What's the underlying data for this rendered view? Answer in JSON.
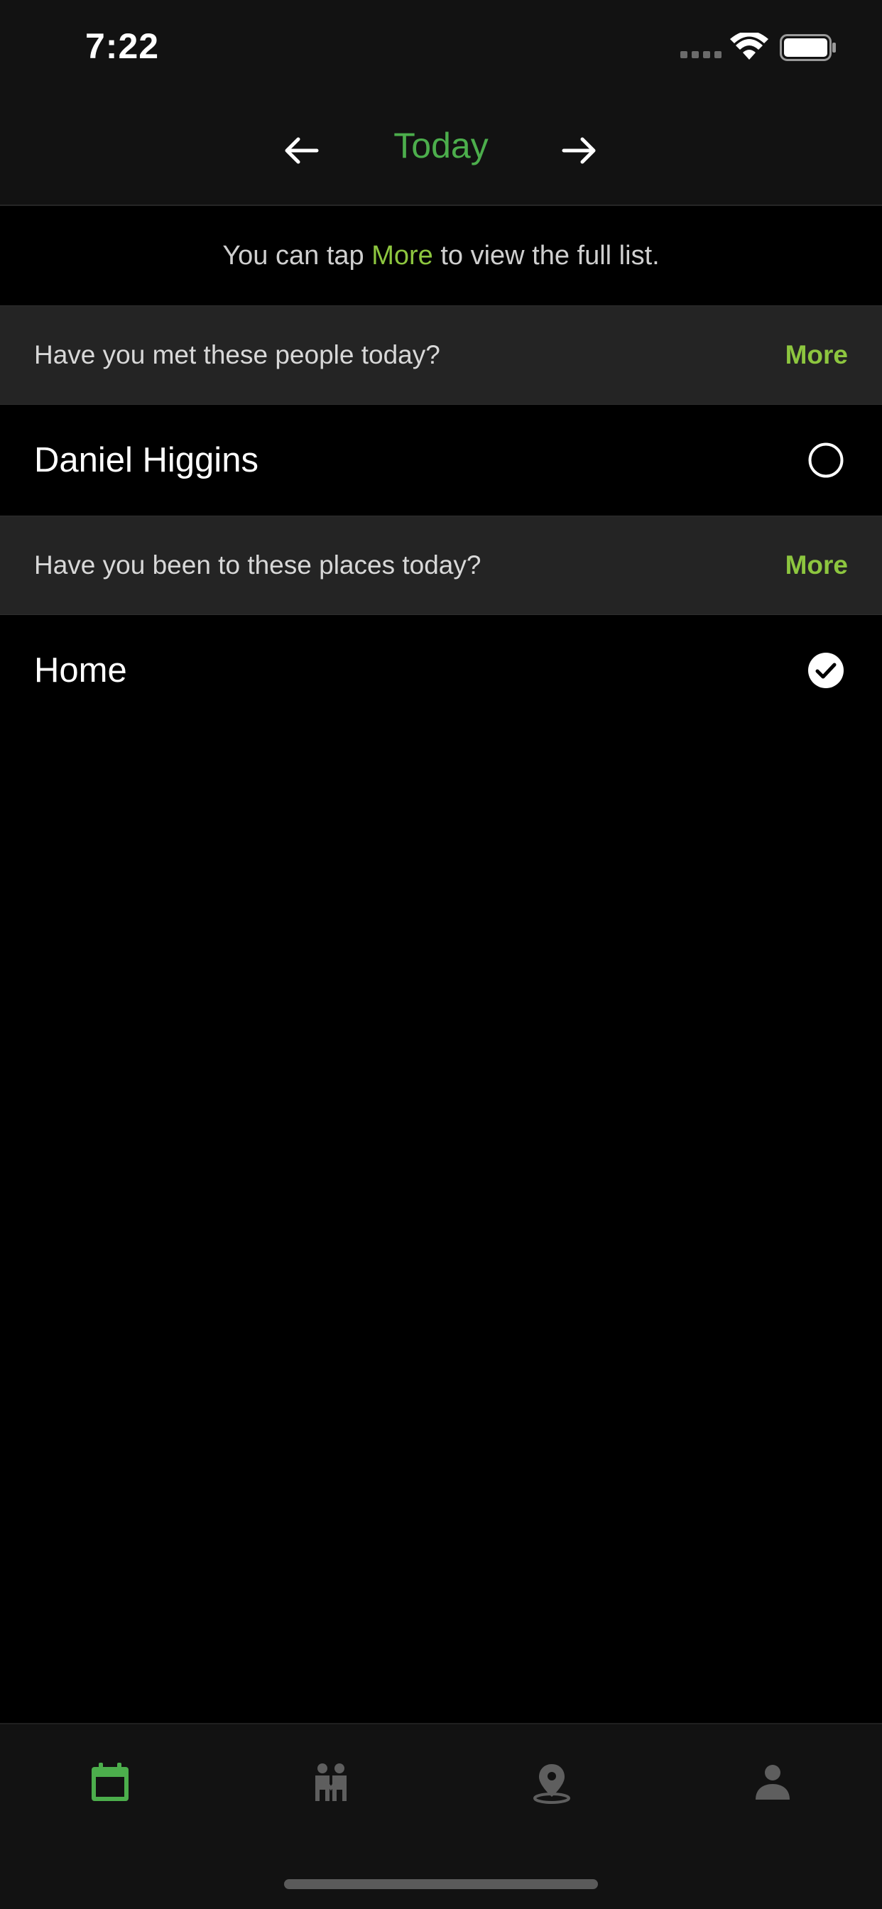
{
  "status_bar": {
    "time": "7:22"
  },
  "header": {
    "title": "Today",
    "prev_icon": "arrow-left-icon",
    "next_icon": "arrow-right-icon"
  },
  "hint": {
    "prefix": "You can tap ",
    "link": "More",
    "suffix": " to view the full list."
  },
  "sections": [
    {
      "question": "Have you met these people today?",
      "more_label": "More",
      "items": [
        {
          "label": "Daniel Higgins",
          "checked": false
        }
      ]
    },
    {
      "question": "Have you been to these places today?",
      "more_label": "More",
      "items": [
        {
          "label": "Home",
          "checked": true
        }
      ]
    }
  ],
  "tab_bar": {
    "tabs": [
      {
        "name": "calendar-icon",
        "active": true
      },
      {
        "name": "people-icon",
        "active": false
      },
      {
        "name": "location-pin-icon",
        "active": false
      },
      {
        "name": "person-icon",
        "active": false
      }
    ]
  },
  "colors": {
    "accent": "#4cae4c",
    "more_accent": "#8dc63f",
    "inactive_tab": "#5e5e5e"
  }
}
